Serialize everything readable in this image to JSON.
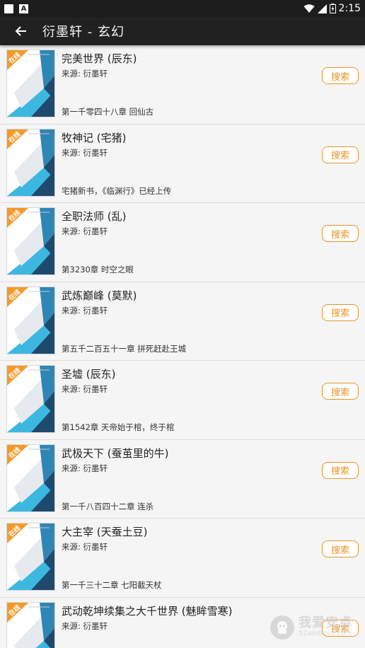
{
  "status_bar": {
    "time": "2:15",
    "icons": [
      "notification-square-icon",
      "a-notification-icon",
      "wifi-icon",
      "signal-icon",
      "battery-icon"
    ]
  },
  "app_bar": {
    "title": "衍墨轩 - 玄幻",
    "back_icon": "arrow-left-icon"
  },
  "cover_badge": "在线",
  "colors": {
    "accent": "#e8952a",
    "appbar": "#212121",
    "statusbar": "#1d1d1d",
    "cover_cyan": "#3cb8e0",
    "cover_navy": "#1f4a6e"
  },
  "books": [
    {
      "title": "完美世界 (辰东)",
      "source": "来源: 衍墨轩",
      "chapter": "第一千零四十八章 回仙古",
      "button": "搜索"
    },
    {
      "title": "牧神记 (宅猪)",
      "source": "来源: 衍墨轩",
      "chapter": "宅猪新书，《临渊行》已经上传",
      "button": "搜索"
    },
    {
      "title": "全职法师 (乱)",
      "source": "来源: 衍墨轩",
      "chapter": "第3230章 时空之眼",
      "button": "搜索"
    },
    {
      "title": "武炼巅峰 (莫默)",
      "source": "来源: 衍墨轩",
      "chapter": "第五千二百五十一章 拼死赶赴王城",
      "button": "搜索"
    },
    {
      "title": "圣墟 (辰东)",
      "source": "来源: 衍墨轩",
      "chapter": "第1542章 天帝始于棺，终于棺",
      "button": "搜索"
    },
    {
      "title": "武极天下 (蚕茧里的牛)",
      "source": "来源: 衍墨轩",
      "chapter": "第一千八百四十二章 连杀",
      "button": "搜索"
    },
    {
      "title": "大主宰 (天蚕土豆)",
      "source": "来源: 衍墨轩",
      "chapter": "第一千三十二章 七阳截天杖",
      "button": "搜索"
    },
    {
      "title": "武动乾坤续集之大千世界 (魅眸雪寒)",
      "source": "来源: 衍墨轩",
      "chapter": "",
      "button": "搜索"
    }
  ],
  "watermark": {
    "main": "我爱安卓",
    "sub": "52android.com"
  }
}
